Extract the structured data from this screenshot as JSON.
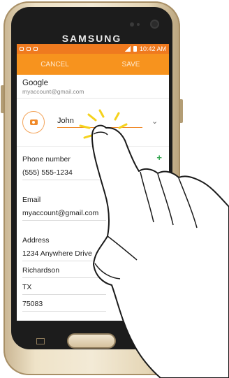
{
  "device": {
    "brand": "SAMSUNG"
  },
  "status": {
    "time": "10:42 AM"
  },
  "actionbar": {
    "cancel": "CANCEL",
    "save": "SAVE"
  },
  "account": {
    "name": "Google",
    "email": "myaccount@gmail.com"
  },
  "contact": {
    "name_value": "John",
    "phone_label": "Phone number",
    "phone_value": "(555) 555-1234",
    "email_label": "Email",
    "email_value": "myaccount@gmail.com",
    "address_label": "Address",
    "address_lines": [
      "1234 Anywhere Drive",
      "Richardson",
      "TX",
      "75083"
    ]
  },
  "icons": {
    "photo": "camera-icon",
    "expand": "chevron-down-icon",
    "add": "plus-icon"
  },
  "colors": {
    "statusbar": "#ef7a1f",
    "actionbar": "#f7931e",
    "accent": "#f08a2a",
    "plus": "#2da24a",
    "phone_body": "#efe3c8"
  }
}
